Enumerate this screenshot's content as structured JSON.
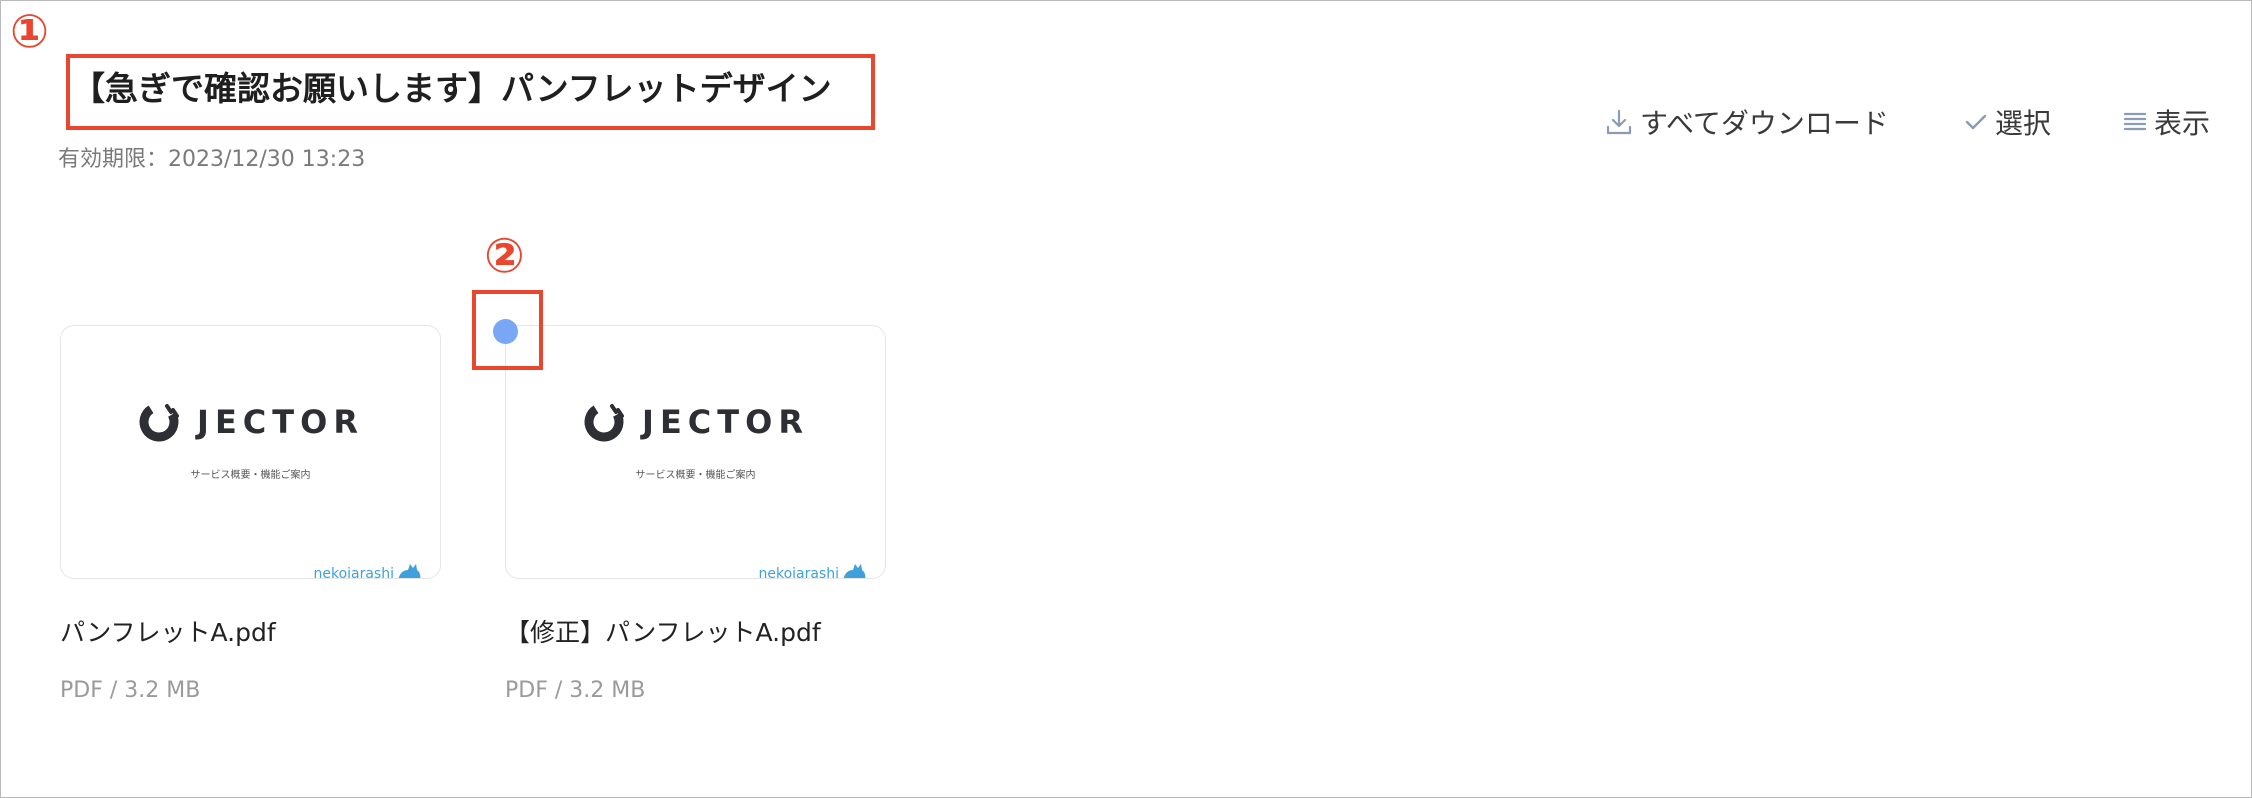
{
  "annotations": {
    "marker_1": "①",
    "marker_2": "②"
  },
  "header": {
    "title": "【急ぎで確認お願いします】パンフレットデザイン",
    "expiry": "有効期限：2023/12/30 13:23"
  },
  "toolbar": {
    "download_all_label": "すべてダウンロード",
    "download_icon": "download-icon",
    "select_label": "選択",
    "select_icon": "check-icon",
    "view_label": "表示",
    "view_icon": "list-icon"
  },
  "files": [
    {
      "name": "パンフレットA.pdf",
      "meta": "PDF / 3.2 MB",
      "thumbnail": {
        "brand": "JECTOR",
        "subtitle": "サービス概要・機能ご案内",
        "footer": "nekoiarashi"
      }
    },
    {
      "name": "【修正】パンフレットA.pdf",
      "meta": "PDF / 3.2 MB",
      "thumbnail": {
        "brand": "JECTOR",
        "subtitle": "サービス概要・機能ご案内",
        "footer": "nekoiarashi"
      }
    }
  ],
  "colors": {
    "annotation": "#e8462f",
    "select_dot": "#7aa7f5",
    "brand_blue": "#3fa0db"
  }
}
